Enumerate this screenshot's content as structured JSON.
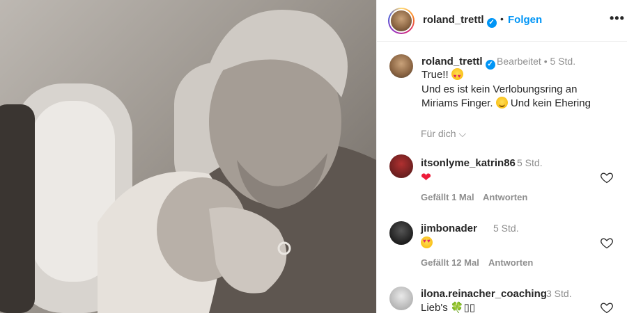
{
  "post": {
    "author": "roland_trettl",
    "follow_label": "Folgen",
    "separator": "•",
    "more_label": "•••"
  },
  "caption": {
    "author": "roland_trettl",
    "meta": "Bearbeitet • 5 Std.",
    "line1": "True!!",
    "line2": "Und es ist kein Verlobungsring an",
    "line3": "Miriams Finger.",
    "line3b": "Und kein Ehering",
    "for_you": "Für dich ⌵"
  },
  "comments": [
    {
      "user": "itsonlyme_katrin86",
      "time": "5 Std.",
      "text": "❤",
      "likes": "Gefällt 1 Mal",
      "reply": "Antworten"
    },
    {
      "user": "jimbonader",
      "time": "5 Std.",
      "text": "",
      "likes": "Gefällt 12 Mal",
      "reply": "Antworten"
    },
    {
      "user": "ilona.reinacher_coaching",
      "time": "3 Std.",
      "text": "Lieb's 🍀▯▯"
    }
  ],
  "icons": {
    "verified": "verified-badge-icon",
    "heart": "heart-outline-icon",
    "more": "more-horizontal-icon"
  },
  "colors": {
    "accent": "#0095f6",
    "muted": "#8e8e8e",
    "text": "#262626"
  }
}
